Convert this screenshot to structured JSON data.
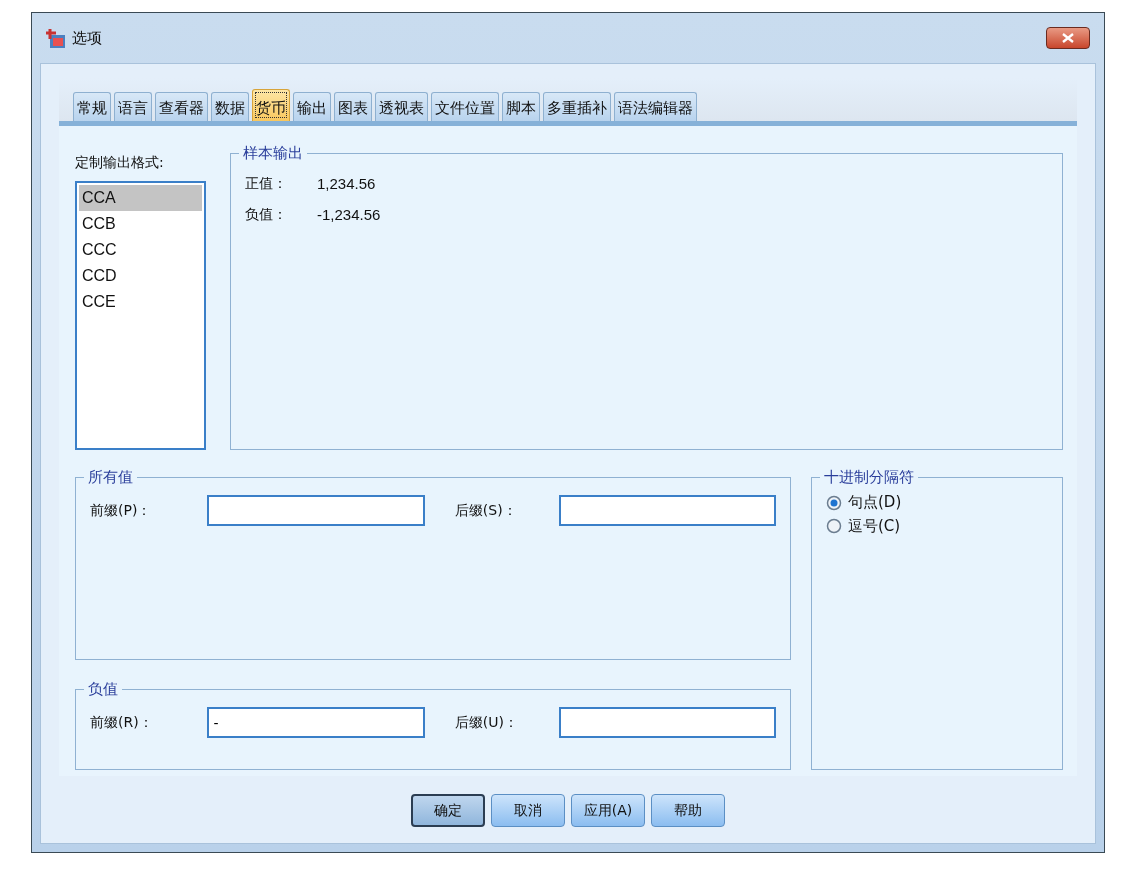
{
  "window": {
    "title": "选项"
  },
  "tabs": [
    {
      "label": "常规",
      "selected": false
    },
    {
      "label": "语言",
      "selected": false
    },
    {
      "label": "查看器",
      "selected": false
    },
    {
      "label": "数据",
      "selected": false
    },
    {
      "label": "货币",
      "selected": true
    },
    {
      "label": "输出",
      "selected": false
    },
    {
      "label": "图表",
      "selected": false
    },
    {
      "label": "透视表",
      "selected": false
    },
    {
      "label": "文件位置",
      "selected": false
    },
    {
      "label": "脚本",
      "selected": false
    },
    {
      "label": "多重插补",
      "selected": false
    },
    {
      "label": "语法编辑器",
      "selected": false
    }
  ],
  "custom_formats": {
    "label": "定制输出格式:",
    "items": [
      {
        "label": "CCA",
        "selected": true
      },
      {
        "label": "CCB",
        "selected": false
      },
      {
        "label": "CCC",
        "selected": false
      },
      {
        "label": "CCD",
        "selected": false
      },
      {
        "label": "CCE",
        "selected": false
      }
    ]
  },
  "sample_output": {
    "title": "样本输出",
    "rows": [
      {
        "label": "正值：",
        "value": "1,234.56"
      },
      {
        "label": "负值：",
        "value": "-1,234.56"
      }
    ]
  },
  "all_values": {
    "title": "所有值",
    "fields": [
      {
        "label": "前缀(P)："
      },
      {
        "label": "后缀(S)："
      }
    ]
  },
  "negative_values": {
    "title": "负值",
    "fields": [
      {
        "label": "前缀(R)：",
        "value": "-"
      },
      {
        "label": "后缀(U)："
      }
    ]
  },
  "decimal_separator": {
    "title": "十进制分隔符",
    "options": [
      {
        "label": "句点(D)",
        "selected": true
      },
      {
        "label": "逗号(C)",
        "selected": false
      }
    ]
  },
  "buttons": [
    {
      "label": "确定",
      "default": true
    },
    {
      "label": "取消",
      "default": false
    },
    {
      "label": "应用(A)",
      "default": false
    },
    {
      "label": "帮助",
      "default": false
    }
  ]
}
